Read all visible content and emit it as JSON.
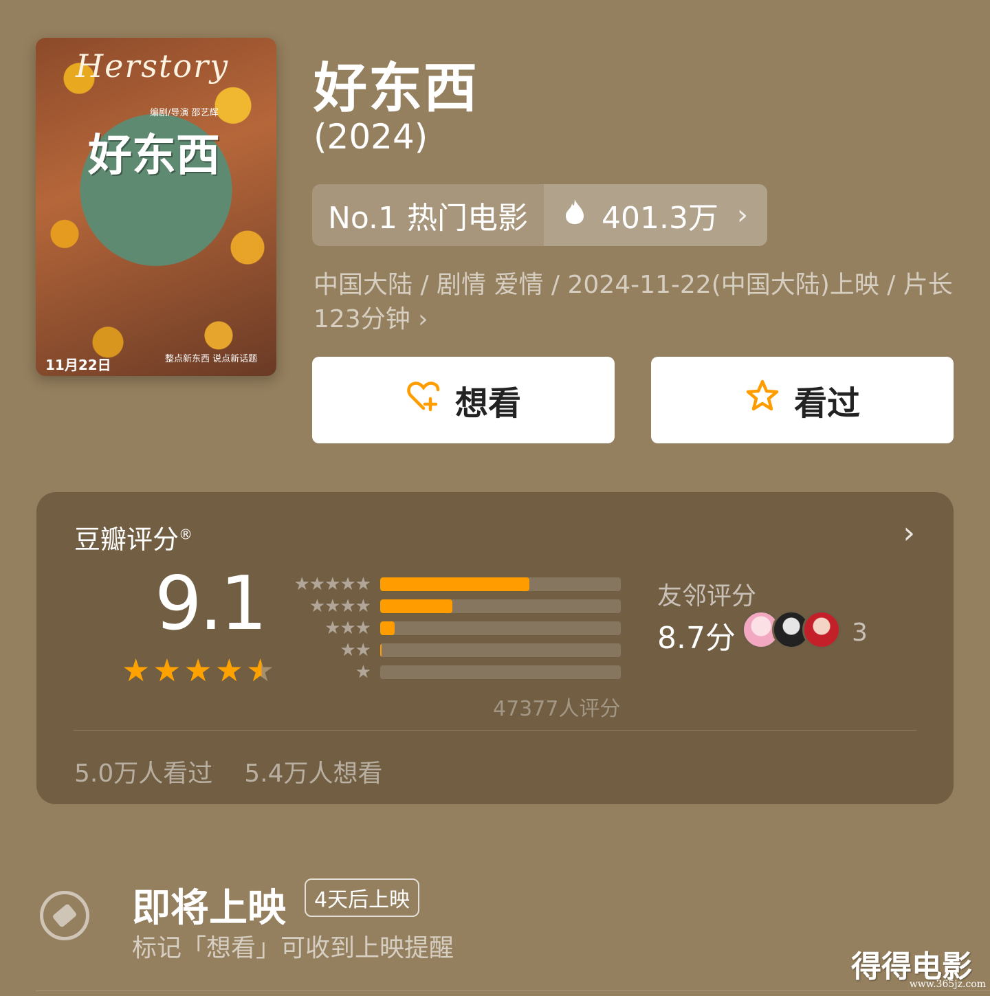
{
  "poster": {
    "script_text": "Herstory",
    "title": "好东西",
    "credit": "编剧/导演 邵艺辉",
    "date": "11月22日",
    "tagline": "整点新东西 说点新话题"
  },
  "movie": {
    "title": "好东西",
    "year": "(2024)",
    "rank_label": "No.1 热门电影",
    "heat": "401.3万",
    "meta": "中国大陆 / 剧情 爱情 / 2024-11-22(中国大陆)上映 / 片长123分钟 ›"
  },
  "actions": {
    "want_label": "想看",
    "seen_label": "看过"
  },
  "rating": {
    "title": "豆瓣评分",
    "registered": "®",
    "score": "9.1",
    "star_value": 4.5,
    "distribution": [
      {
        "stars": "★★★★★",
        "fraction": 0.62
      },
      {
        "stars": "★★★★",
        "fraction": 0.3
      },
      {
        "stars": "★★★",
        "fraction": 0.06
      },
      {
        "stars": "★★",
        "fraction": 0.008
      },
      {
        "stars": "★",
        "fraction": 0.0
      }
    ],
    "count": "47377人评分",
    "friends_label": "友邻评分",
    "friends_score": "8.7分",
    "friends_count": "3",
    "seen_count": "5.0万人看过",
    "want_count": "5.4万人想看"
  },
  "upcoming": {
    "title": "即将上映",
    "badge": "4天后上映",
    "subtitle": "标记「想看」可收到上映提醒"
  },
  "watermark": {
    "text": "得得电影",
    "url": "www.365jz.com"
  },
  "colors": {
    "background": "#947f5e",
    "accent": "#ff9d00"
  }
}
